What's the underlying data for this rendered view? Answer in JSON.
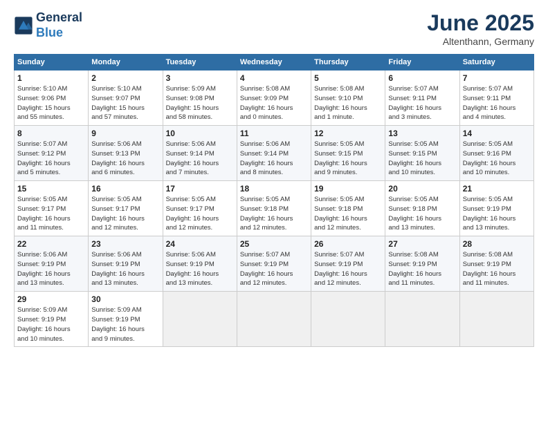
{
  "logo": {
    "line1": "General",
    "line2": "Blue"
  },
  "header": {
    "month": "June 2025",
    "location": "Altenthann, Germany"
  },
  "weekdays": [
    "Sunday",
    "Monday",
    "Tuesday",
    "Wednesday",
    "Thursday",
    "Friday",
    "Saturday"
  ],
  "weeks": [
    [
      {
        "day": "1",
        "info": "Sunrise: 5:10 AM\nSunset: 9:06 PM\nDaylight: 15 hours\nand 55 minutes."
      },
      {
        "day": "2",
        "info": "Sunrise: 5:10 AM\nSunset: 9:07 PM\nDaylight: 15 hours\nand 57 minutes."
      },
      {
        "day": "3",
        "info": "Sunrise: 5:09 AM\nSunset: 9:08 PM\nDaylight: 15 hours\nand 58 minutes."
      },
      {
        "day": "4",
        "info": "Sunrise: 5:08 AM\nSunset: 9:09 PM\nDaylight: 16 hours\nand 0 minutes."
      },
      {
        "day": "5",
        "info": "Sunrise: 5:08 AM\nSunset: 9:10 PM\nDaylight: 16 hours\nand 1 minute."
      },
      {
        "day": "6",
        "info": "Sunrise: 5:07 AM\nSunset: 9:11 PM\nDaylight: 16 hours\nand 3 minutes."
      },
      {
        "day": "7",
        "info": "Sunrise: 5:07 AM\nSunset: 9:11 PM\nDaylight: 16 hours\nand 4 minutes."
      }
    ],
    [
      {
        "day": "8",
        "info": "Sunrise: 5:07 AM\nSunset: 9:12 PM\nDaylight: 16 hours\nand 5 minutes."
      },
      {
        "day": "9",
        "info": "Sunrise: 5:06 AM\nSunset: 9:13 PM\nDaylight: 16 hours\nand 6 minutes."
      },
      {
        "day": "10",
        "info": "Sunrise: 5:06 AM\nSunset: 9:14 PM\nDaylight: 16 hours\nand 7 minutes."
      },
      {
        "day": "11",
        "info": "Sunrise: 5:06 AM\nSunset: 9:14 PM\nDaylight: 16 hours\nand 8 minutes."
      },
      {
        "day": "12",
        "info": "Sunrise: 5:05 AM\nSunset: 9:15 PM\nDaylight: 16 hours\nand 9 minutes."
      },
      {
        "day": "13",
        "info": "Sunrise: 5:05 AM\nSunset: 9:15 PM\nDaylight: 16 hours\nand 10 minutes."
      },
      {
        "day": "14",
        "info": "Sunrise: 5:05 AM\nSunset: 9:16 PM\nDaylight: 16 hours\nand 10 minutes."
      }
    ],
    [
      {
        "day": "15",
        "info": "Sunrise: 5:05 AM\nSunset: 9:17 PM\nDaylight: 16 hours\nand 11 minutes."
      },
      {
        "day": "16",
        "info": "Sunrise: 5:05 AM\nSunset: 9:17 PM\nDaylight: 16 hours\nand 12 minutes."
      },
      {
        "day": "17",
        "info": "Sunrise: 5:05 AM\nSunset: 9:17 PM\nDaylight: 16 hours\nand 12 minutes."
      },
      {
        "day": "18",
        "info": "Sunrise: 5:05 AM\nSunset: 9:18 PM\nDaylight: 16 hours\nand 12 minutes."
      },
      {
        "day": "19",
        "info": "Sunrise: 5:05 AM\nSunset: 9:18 PM\nDaylight: 16 hours\nand 12 minutes."
      },
      {
        "day": "20",
        "info": "Sunrise: 5:05 AM\nSunset: 9:18 PM\nDaylight: 16 hours\nand 13 minutes."
      },
      {
        "day": "21",
        "info": "Sunrise: 5:05 AM\nSunset: 9:19 PM\nDaylight: 16 hours\nand 13 minutes."
      }
    ],
    [
      {
        "day": "22",
        "info": "Sunrise: 5:06 AM\nSunset: 9:19 PM\nDaylight: 16 hours\nand 13 minutes."
      },
      {
        "day": "23",
        "info": "Sunrise: 5:06 AM\nSunset: 9:19 PM\nDaylight: 16 hours\nand 13 minutes."
      },
      {
        "day": "24",
        "info": "Sunrise: 5:06 AM\nSunset: 9:19 PM\nDaylight: 16 hours\nand 13 minutes."
      },
      {
        "day": "25",
        "info": "Sunrise: 5:07 AM\nSunset: 9:19 PM\nDaylight: 16 hours\nand 12 minutes."
      },
      {
        "day": "26",
        "info": "Sunrise: 5:07 AM\nSunset: 9:19 PM\nDaylight: 16 hours\nand 12 minutes."
      },
      {
        "day": "27",
        "info": "Sunrise: 5:08 AM\nSunset: 9:19 PM\nDaylight: 16 hours\nand 11 minutes."
      },
      {
        "day": "28",
        "info": "Sunrise: 5:08 AM\nSunset: 9:19 PM\nDaylight: 16 hours\nand 11 minutes."
      }
    ],
    [
      {
        "day": "29",
        "info": "Sunrise: 5:09 AM\nSunset: 9:19 PM\nDaylight: 16 hours\nand 10 minutes."
      },
      {
        "day": "30",
        "info": "Sunrise: 5:09 AM\nSunset: 9:19 PM\nDaylight: 16 hours\nand 9 minutes."
      },
      {
        "day": "",
        "info": ""
      },
      {
        "day": "",
        "info": ""
      },
      {
        "day": "",
        "info": ""
      },
      {
        "day": "",
        "info": ""
      },
      {
        "day": "",
        "info": ""
      }
    ]
  ]
}
